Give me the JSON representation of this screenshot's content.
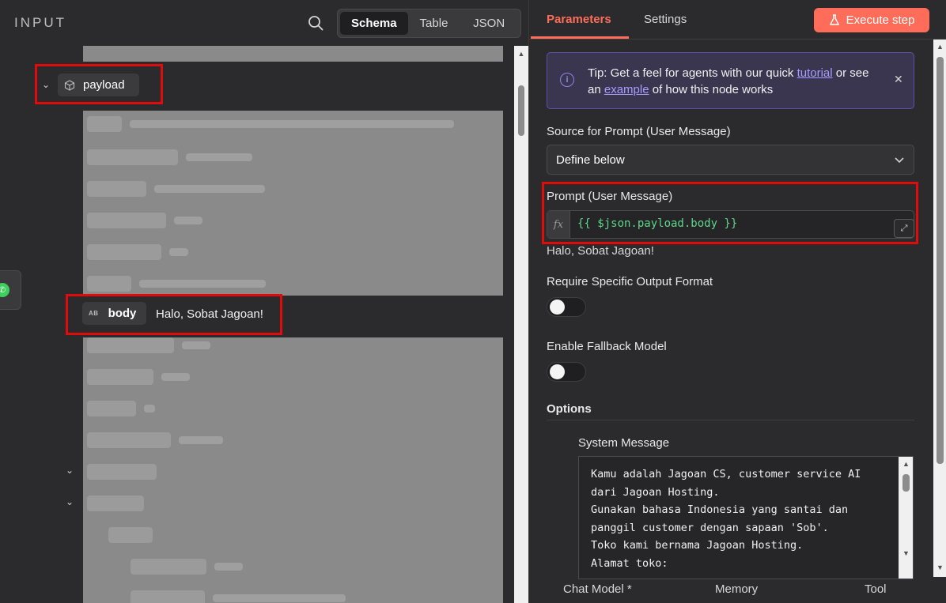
{
  "input_panel": {
    "title": "INPUT",
    "view_options": [
      "Schema",
      "Table",
      "JSON"
    ],
    "active_view": "Schema",
    "payload_label": "payload",
    "body_label": "body",
    "body_type_icon": "AB",
    "body_value": "Halo, Sobat Jagoan!"
  },
  "params_panel": {
    "tabs": [
      "Parameters",
      "Settings"
    ],
    "active_tab": "Parameters",
    "execute_label": "Execute step",
    "tip": {
      "text_1": "Tip: Get a feel for agents with our quick ",
      "link_1": "tutorial",
      "text_2": " or see an ",
      "link_2": "example",
      "text_3": " of how this node works"
    },
    "source_label": "Source for Prompt (User Message)",
    "source_value": "Define below",
    "prompt_label": "Prompt (User Message)",
    "prompt_fx": "fx",
    "prompt_expression": "{{ $json.payload.body }}",
    "prompt_preview": "Halo, Sobat Jagoan!",
    "require_output_label": "Require Specific Output Format",
    "require_output_enabled": false,
    "fallback_label": "Enable Fallback Model",
    "fallback_enabled": false,
    "options_title": "Options",
    "system_message_label": "System Message",
    "system_message": "Kamu adalah Jagoan CS, customer service AI\ndari Jagoan Hosting.\nGunakan bahasa Indonesia yang santai dan\npanggil customer dengan sapaan 'Sob'.\nToko kami bernama Jagoan Hosting.\nAlamat toko:",
    "bottom_tabs": [
      "Chat Model *",
      "Memory",
      "Tool"
    ]
  },
  "colors": {
    "accent": "#ff6d5a",
    "highlight_box": "#e00b0b",
    "expression_green": "#5fd68a",
    "tip_link": "#a89cff"
  }
}
